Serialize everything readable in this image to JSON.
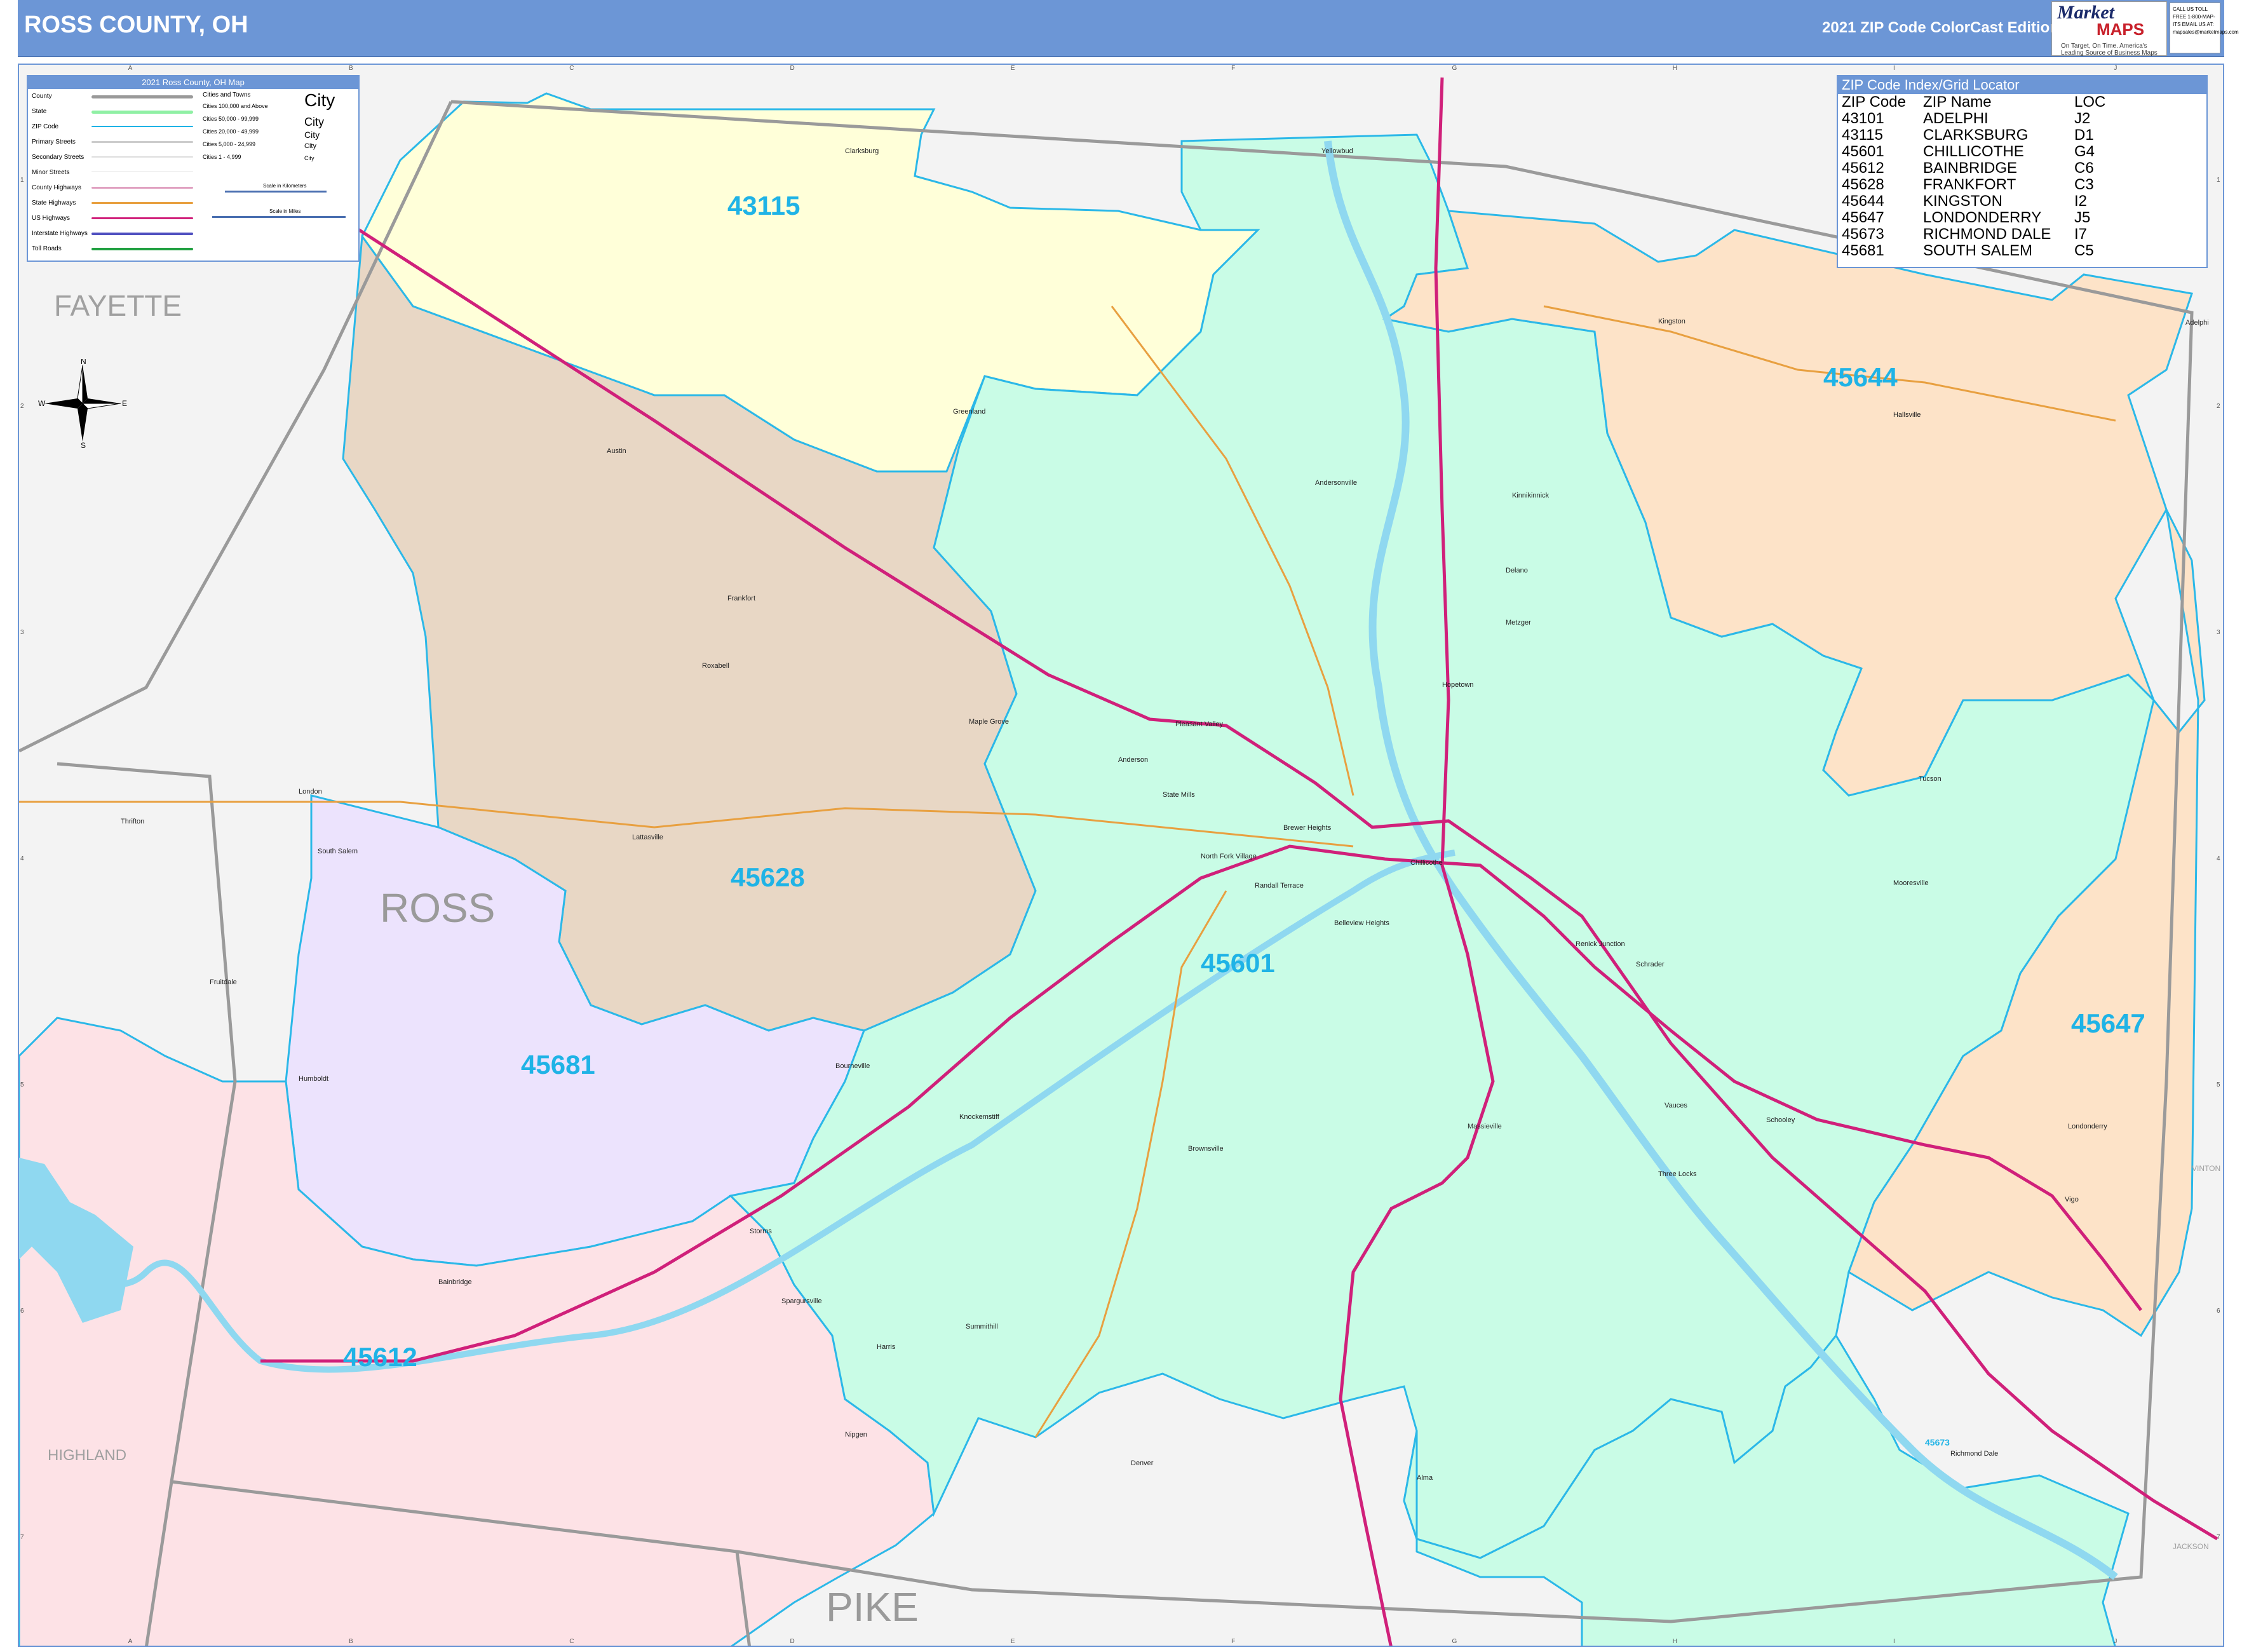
{
  "header": {
    "title": "ROSS COUNTY, OH",
    "edition": "2021 ZIP Code ColorCast Edition",
    "logo_main": "Market",
    "logo_sub": "MAPS",
    "logo_tagline": "On Target, On Time. America's Leading Source of Business Maps",
    "phone_box": "CALL US TOLL FREE 1-800-MAP-ITS EMAIL US AT: mapsales@marketmaps.com"
  },
  "legend": {
    "title": "2021 Ross County, OH Map",
    "rows": [
      "County",
      "State",
      "ZIP Code",
      "Primary Streets",
      "Secondary Streets",
      "Minor Streets",
      "County Highways",
      "State Highways",
      "US Highways",
      "Interstate Highways",
      "Toll Roads"
    ],
    "cities_header": "Cities and Towns",
    "city_sizes": [
      "Cities 100,000 and Above",
      "Cities 50,000 - 99,999",
      "Cities 20,000 - 49,999",
      "Cities 5,000 - 24,999",
      "Cities 1 - 4,999"
    ],
    "city_samples": [
      "City",
      "City",
      "City",
      "City",
      "City"
    ],
    "scale_km": "Scale in Kilometers",
    "scale_mi": "Scale in Miles",
    "colors": {
      "county": "#999999",
      "state": "#8ff0a4",
      "zip": "#1fb3e6",
      "primary": "#cccccc",
      "secondary": "#dddddd",
      "minor": "#eeeeee",
      "county_hwy": "#e0a0c0",
      "state_hwy": "#e8a040",
      "us_hwy": "#d0207a",
      "interstate": "#5050c0",
      "toll": "#20a040"
    }
  },
  "zip_index": {
    "title": "ZIP Code Index/Grid Locator",
    "columns": [
      "ZIP Code",
      "ZIP Name",
      "LOC"
    ],
    "rows": [
      [
        "43101",
        "ADELPHI",
        "J2"
      ],
      [
        "43115",
        "CLARKSBURG",
        "D1"
      ],
      [
        "45601",
        "CHILLICOTHE",
        "G4"
      ],
      [
        "45612",
        "BAINBRIDGE",
        "C6"
      ],
      [
        "45628",
        "FRANKFORT",
        "C3"
      ],
      [
        "45644",
        "KINGSTON",
        "I2"
      ],
      [
        "45647",
        "LONDONDERRY",
        "J5"
      ],
      [
        "45673",
        "RICHMOND DALE",
        "I7"
      ],
      [
        "45681",
        "SOUTH SALEM",
        "C5"
      ]
    ]
  },
  "zip_labels": {
    "z43115": "43115",
    "z45644": "45644",
    "z45628": "45628",
    "z45601": "45601",
    "z45681": "45681",
    "z45647": "45647",
    "z45612": "45612",
    "z45673": "45673"
  },
  "county_labels": {
    "fayette": "FAYETTE",
    "ross": "ROSS",
    "pike": "PIKE",
    "highland": "HIGHLAND",
    "vinton": "VINTON",
    "jackson": "JACKSON"
  },
  "towns": {
    "clarksburg": "Clarksburg",
    "yellowbud": "Yellowbud",
    "kingston": "Kingston",
    "adelphi": "Adelphi",
    "hallsville": "Hallsville",
    "greenland": "Greenland",
    "austin": "Austin",
    "andersonville": "Andersonville",
    "kinnikinnick": "Kinnikinnick",
    "delano": "Delano",
    "metzger": "Metzger",
    "frankfort": "Frankfort",
    "roxabell": "Roxabell",
    "maple_grove": "Maple Grove",
    "pleasant_valley": "Pleasant Valley",
    "anderson": "Anderson",
    "hopetown": "Hopetown",
    "thrifton": "Thrifton",
    "london": "London",
    "lattasville": "Lattasville",
    "south_salem": "South Salem",
    "state_mills": "State Mills",
    "brewer_heights": "Brewer Heights",
    "north_fork_village": "North Fork Village",
    "randall_terrace": "Randall Terrace",
    "chillicothe": "Chillicothe",
    "belleview_heights": "Belleview Heights",
    "tucson": "Tucson",
    "mooresville": "Mooresville",
    "renick_junction": "Renick Junction",
    "schrader": "Schrader",
    "fruitdale": "Fruitdale",
    "humboldt": "Humboldt",
    "bourneville": "Bourneville",
    "knockemstiff": "Knockemstiff",
    "brownsville": "Brownsville",
    "massieville": "Massieville",
    "vauces": "Vauces",
    "schooley": "Schooley",
    "londonderry": "Londonderry",
    "three_locks": "Three Locks",
    "vigo": "Vigo",
    "storms": "Storms",
    "bainbridge": "Bainbridge",
    "spargursville": "Spargursville",
    "harris": "Harris",
    "summithill": "Summithill",
    "nipgen": "Nipgen",
    "denver": "Denver",
    "alma": "Alma",
    "richmond_dale": "Richmond Dale"
  },
  "grid_cols": [
    "A",
    "B",
    "C",
    "D",
    "E",
    "F",
    "G",
    "H",
    "I",
    "J"
  ],
  "grid_rows": [
    "1",
    "2",
    "3",
    "4",
    "5",
    "6",
    "7"
  ],
  "compass": {
    "n": "N",
    "s": "S",
    "e": "E",
    "w": "W"
  },
  "zone_colors": {
    "z43115": "#ffffd9",
    "z45644": "#fde3c8",
    "z45647": "#fde3c8",
    "z45628": "#e8d7c5",
    "z45601": "#c9fce6",
    "z45673": "#c9fce6",
    "z45681": "#ece3fd",
    "z45612": "#fde2e6",
    "outside": "#f3f3f3",
    "zip_border": "#2bb8e8",
    "county_border": "#9a9a9a",
    "water": "#8fd8f0",
    "us_hwy": "#d0207a",
    "state_hwy": "#e8a040"
  }
}
